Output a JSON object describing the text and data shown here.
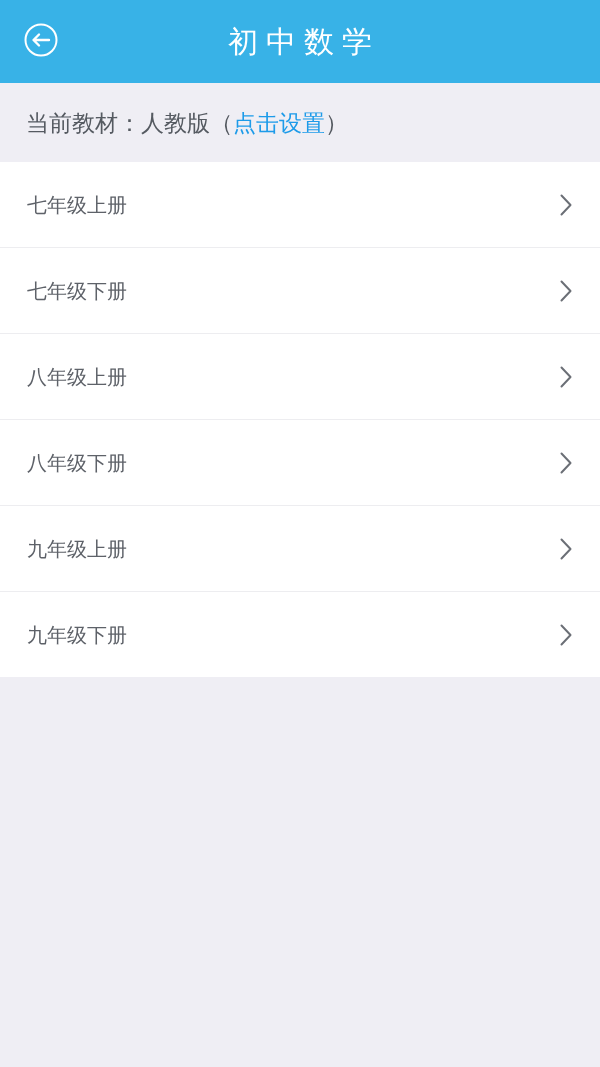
{
  "header": {
    "title": "初中数学"
  },
  "notice": {
    "text_before": "当前教材：人教版（",
    "link": "点击设置",
    "text_after": "）"
  },
  "grades": [
    {
      "label": "七年级上册"
    },
    {
      "label": "七年级下册"
    },
    {
      "label": "八年级上册"
    },
    {
      "label": "八年级下册"
    },
    {
      "label": "九年级上册"
    },
    {
      "label": "九年级下册"
    }
  ]
}
